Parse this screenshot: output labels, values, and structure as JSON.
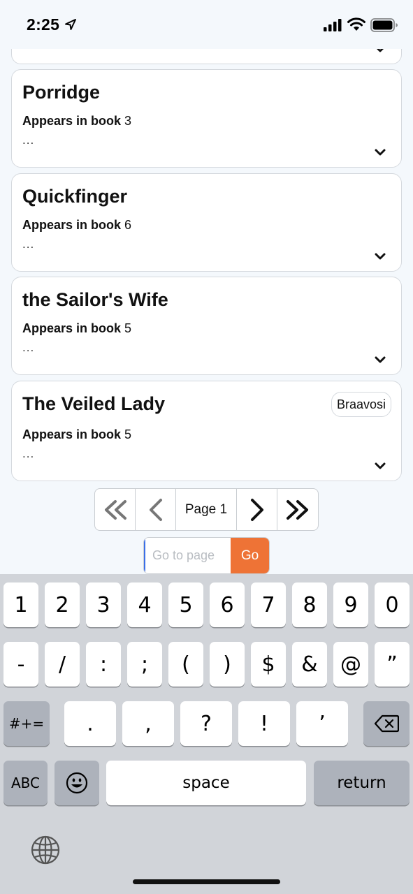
{
  "status_bar": {
    "time": "2:25"
  },
  "cards": [
    {
      "title": "Porridge",
      "meta_label": "Appears in book",
      "meta_value": "3",
      "excerpt": "...",
      "tag": ""
    },
    {
      "title": "Quickfinger",
      "meta_label": "Appears in book",
      "meta_value": "6",
      "excerpt": "...",
      "tag": ""
    },
    {
      "title": "the Sailor's Wife",
      "meta_label": "Appears in book",
      "meta_value": "5",
      "excerpt": "...",
      "tag": ""
    },
    {
      "title": "The Veiled Lady",
      "meta_label": "Appears in book",
      "meta_value": "5",
      "excerpt": "...",
      "tag": "Braavosi"
    }
  ],
  "pagination": {
    "page_label": "Page 1",
    "goto_placeholder": "Go to page",
    "go_label": "Go"
  },
  "colors": {
    "accent": "#ee7336",
    "background": "#f4f8fc",
    "keyboard": "#d1d4d9"
  },
  "keyboard": {
    "row1": [
      "1",
      "2",
      "3",
      "4",
      "5",
      "6",
      "7",
      "8",
      "9",
      "0"
    ],
    "row2": [
      "-",
      "/",
      ":",
      ";",
      "(",
      ")",
      "$",
      "&",
      "@",
      "”"
    ],
    "symbols_toggle": "#+=",
    "row3": [
      ".",
      ",",
      "?",
      "!",
      "’"
    ],
    "abc": "ABC",
    "space": "space",
    "return": "return"
  }
}
